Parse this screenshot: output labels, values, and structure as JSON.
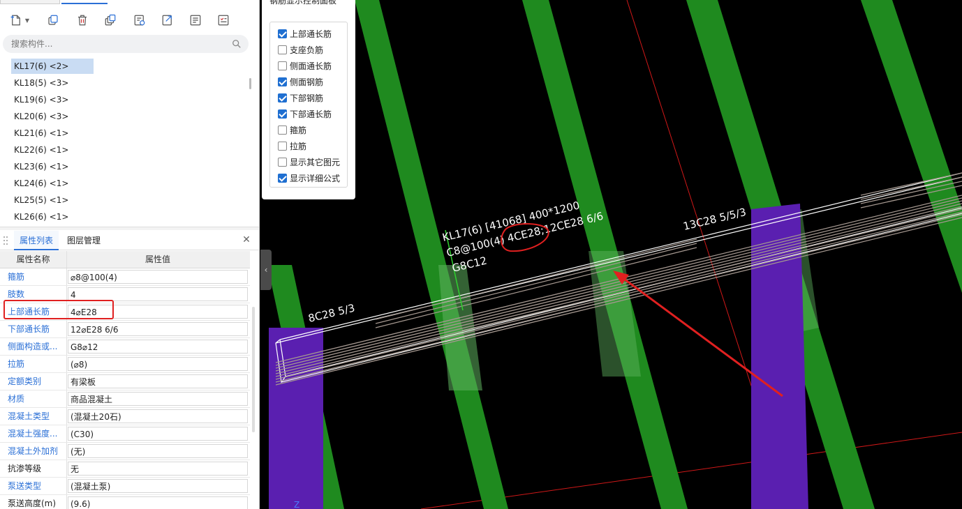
{
  "top_tabs": [
    "",
    ""
  ],
  "search": {
    "placeholder": "搜索构件..."
  },
  "components": [
    {
      "label": "KL17(6)  <2>",
      "selected": true
    },
    {
      "label": "KL18(5)  <3>"
    },
    {
      "label": "KL19(6)  <3>"
    },
    {
      "label": "KL20(6)  <3>"
    },
    {
      "label": "KL21(6)  <1>"
    },
    {
      "label": "KL22(6)  <1>"
    },
    {
      "label": "KL23(6)  <1>"
    },
    {
      "label": "KL24(6)  <1>"
    },
    {
      "label": "KL25(5)  <1>"
    },
    {
      "label": "KL26(6)  <1>"
    }
  ],
  "prop_panel": {
    "tab_active": "属性列表",
    "tab_other": "图层管理",
    "col_name": "属性名称",
    "col_value": "属性值",
    "rows": [
      {
        "name": "箍筋",
        "value": "⌀8@100(4)",
        "blue": true
      },
      {
        "name": "肢数",
        "value": "4",
        "blue": true
      },
      {
        "name": "上部通长筋",
        "value": "4⌀E28",
        "blue": true
      },
      {
        "name": "下部通长筋",
        "value": "12⌀E28 6/6",
        "blue": true
      },
      {
        "name": "侧面构造或...",
        "value": "G8⌀12",
        "blue": true
      },
      {
        "name": "拉筋",
        "value": "(⌀8)",
        "blue": true
      },
      {
        "name": "定额类别",
        "value": "有梁板",
        "blue": true
      },
      {
        "name": "材质",
        "value": "商品混凝土",
        "blue": true
      },
      {
        "name": "混凝土类型",
        "value": "(混凝土20石)",
        "blue": true
      },
      {
        "name": "混凝土强度...",
        "value": "(C30)",
        "blue": true
      },
      {
        "name": "混凝土外加剂",
        "value": "(无)",
        "blue": true
      },
      {
        "name": "抗渗等级",
        "value": "无",
        "blue": false
      },
      {
        "name": "泵送类型",
        "value": "(混凝土泵)",
        "blue": true
      },
      {
        "name": "泵送高度(m)",
        "value": "(9.6)",
        "blue": false
      }
    ]
  },
  "control_panel": {
    "title": "钢筋显示控制面板",
    "options": [
      {
        "label": "上部通长筋",
        "checked": true
      },
      {
        "label": "支座负筋",
        "checked": false
      },
      {
        "label": "侧面通长筋",
        "checked": false
      },
      {
        "label": "侧面钢筋",
        "checked": true
      },
      {
        "label": "下部钢筋",
        "checked": true
      },
      {
        "label": "下部通长筋",
        "checked": true
      },
      {
        "label": "箍筋",
        "checked": false
      },
      {
        "label": "拉筋",
        "checked": false
      },
      {
        "label": "显示其它图元",
        "checked": false
      },
      {
        "label": "显示详细公式",
        "checked": true
      }
    ]
  },
  "viewport": {
    "annotations": {
      "beam_line1": "KL17(6) [41068] 400*1200",
      "beam_line2": "C8@100(4) 4CE28;12CE28 6/6",
      "beam_line3": "G8C12",
      "left_support": "8C28 5/3",
      "right_support": "13C28 5/5/3"
    },
    "colors": {
      "column_green": "#1f8a1f",
      "column_purple": "#5a1fb0",
      "beam_outline": "#ffffff",
      "rebar": "#a59890",
      "highlight": "#e02020"
    }
  }
}
